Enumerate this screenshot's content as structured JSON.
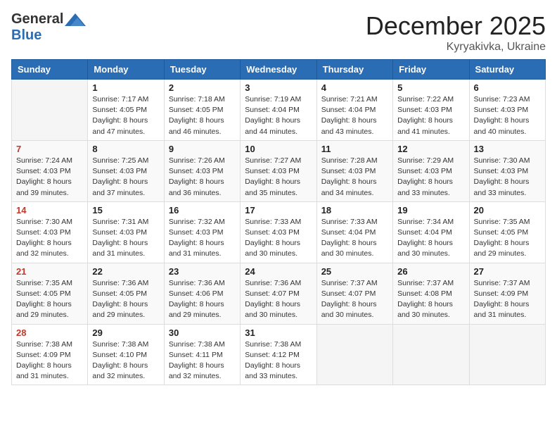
{
  "header": {
    "logo_general": "General",
    "logo_blue": "Blue",
    "month_title": "December 2025",
    "location": "Kyryakivka, Ukraine"
  },
  "calendar": {
    "headers": [
      "Sunday",
      "Monday",
      "Tuesday",
      "Wednesday",
      "Thursday",
      "Friday",
      "Saturday"
    ],
    "weeks": [
      [
        {
          "day": "",
          "info": ""
        },
        {
          "day": "1",
          "info": "Sunrise: 7:17 AM\nSunset: 4:05 PM\nDaylight: 8 hours\nand 47 minutes."
        },
        {
          "day": "2",
          "info": "Sunrise: 7:18 AM\nSunset: 4:05 PM\nDaylight: 8 hours\nand 46 minutes."
        },
        {
          "day": "3",
          "info": "Sunrise: 7:19 AM\nSunset: 4:04 PM\nDaylight: 8 hours\nand 44 minutes."
        },
        {
          "day": "4",
          "info": "Sunrise: 7:21 AM\nSunset: 4:04 PM\nDaylight: 8 hours\nand 43 minutes."
        },
        {
          "day": "5",
          "info": "Sunrise: 7:22 AM\nSunset: 4:03 PM\nDaylight: 8 hours\nand 41 minutes."
        },
        {
          "day": "6",
          "info": "Sunrise: 7:23 AM\nSunset: 4:03 PM\nDaylight: 8 hours\nand 40 minutes."
        }
      ],
      [
        {
          "day": "7",
          "info": "Sunrise: 7:24 AM\nSunset: 4:03 PM\nDaylight: 8 hours\nand 39 minutes."
        },
        {
          "day": "8",
          "info": "Sunrise: 7:25 AM\nSunset: 4:03 PM\nDaylight: 8 hours\nand 37 minutes."
        },
        {
          "day": "9",
          "info": "Sunrise: 7:26 AM\nSunset: 4:03 PM\nDaylight: 8 hours\nand 36 minutes."
        },
        {
          "day": "10",
          "info": "Sunrise: 7:27 AM\nSunset: 4:03 PM\nDaylight: 8 hours\nand 35 minutes."
        },
        {
          "day": "11",
          "info": "Sunrise: 7:28 AM\nSunset: 4:03 PM\nDaylight: 8 hours\nand 34 minutes."
        },
        {
          "day": "12",
          "info": "Sunrise: 7:29 AM\nSunset: 4:03 PM\nDaylight: 8 hours\nand 33 minutes."
        },
        {
          "day": "13",
          "info": "Sunrise: 7:30 AM\nSunset: 4:03 PM\nDaylight: 8 hours\nand 33 minutes."
        }
      ],
      [
        {
          "day": "14",
          "info": "Sunrise: 7:30 AM\nSunset: 4:03 PM\nDaylight: 8 hours\nand 32 minutes."
        },
        {
          "day": "15",
          "info": "Sunrise: 7:31 AM\nSunset: 4:03 PM\nDaylight: 8 hours\nand 31 minutes."
        },
        {
          "day": "16",
          "info": "Sunrise: 7:32 AM\nSunset: 4:03 PM\nDaylight: 8 hours\nand 31 minutes."
        },
        {
          "day": "17",
          "info": "Sunrise: 7:33 AM\nSunset: 4:03 PM\nDaylight: 8 hours\nand 30 minutes."
        },
        {
          "day": "18",
          "info": "Sunrise: 7:33 AM\nSunset: 4:04 PM\nDaylight: 8 hours\nand 30 minutes."
        },
        {
          "day": "19",
          "info": "Sunrise: 7:34 AM\nSunset: 4:04 PM\nDaylight: 8 hours\nand 30 minutes."
        },
        {
          "day": "20",
          "info": "Sunrise: 7:35 AM\nSunset: 4:05 PM\nDaylight: 8 hours\nand 29 minutes."
        }
      ],
      [
        {
          "day": "21",
          "info": "Sunrise: 7:35 AM\nSunset: 4:05 PM\nDaylight: 8 hours\nand 29 minutes."
        },
        {
          "day": "22",
          "info": "Sunrise: 7:36 AM\nSunset: 4:05 PM\nDaylight: 8 hours\nand 29 minutes."
        },
        {
          "day": "23",
          "info": "Sunrise: 7:36 AM\nSunset: 4:06 PM\nDaylight: 8 hours\nand 29 minutes."
        },
        {
          "day": "24",
          "info": "Sunrise: 7:36 AM\nSunset: 4:07 PM\nDaylight: 8 hours\nand 30 minutes."
        },
        {
          "day": "25",
          "info": "Sunrise: 7:37 AM\nSunset: 4:07 PM\nDaylight: 8 hours\nand 30 minutes."
        },
        {
          "day": "26",
          "info": "Sunrise: 7:37 AM\nSunset: 4:08 PM\nDaylight: 8 hours\nand 30 minutes."
        },
        {
          "day": "27",
          "info": "Sunrise: 7:37 AM\nSunset: 4:09 PM\nDaylight: 8 hours\nand 31 minutes."
        }
      ],
      [
        {
          "day": "28",
          "info": "Sunrise: 7:38 AM\nSunset: 4:09 PM\nDaylight: 8 hours\nand 31 minutes."
        },
        {
          "day": "29",
          "info": "Sunrise: 7:38 AM\nSunset: 4:10 PM\nDaylight: 8 hours\nand 32 minutes."
        },
        {
          "day": "30",
          "info": "Sunrise: 7:38 AM\nSunset: 4:11 PM\nDaylight: 8 hours\nand 32 minutes."
        },
        {
          "day": "31",
          "info": "Sunrise: 7:38 AM\nSunset: 4:12 PM\nDaylight: 8 hours\nand 33 minutes."
        },
        {
          "day": "",
          "info": ""
        },
        {
          "day": "",
          "info": ""
        },
        {
          "day": "",
          "info": ""
        }
      ]
    ]
  }
}
